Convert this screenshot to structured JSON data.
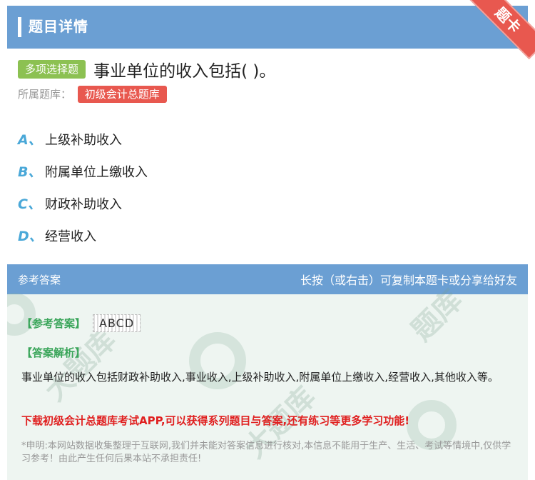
{
  "header": {
    "title": "题目详情",
    "ribbon": "题卡"
  },
  "question": {
    "type_label": "多项选择题",
    "text": "事业单位的收入包括( )。",
    "bank_label": "所属题库：",
    "bank_name": "初级会计总题库"
  },
  "options": [
    {
      "letter": "A、",
      "text": "上级补助收入"
    },
    {
      "letter": "B、",
      "text": "附属单位上缴收入"
    },
    {
      "letter": "C、",
      "text": "财政补助收入"
    },
    {
      "letter": "D、",
      "text": "经营收入"
    }
  ],
  "answer": {
    "header_left": "参考答案",
    "header_right": "长按（或右击）可复制本题卡或分享给好友",
    "ref_label": "【参考答案】",
    "ref_value": "ABCD",
    "analysis_label": "【答案解析】",
    "analysis_text": "事业单位的收入包括财政补助收入,事业收入,上级补助收入,附属单位上缴收入,经营收入,其他收入等。",
    "promo": "下载初级会计总题库考试APP,可以获得系列题目与答案,还有练习等更多学习功能!",
    "disclaimer": "*申明:本网站数据收集整理于互联网,我们并未能对答案信息进行核对,本信息不能用于生产、生活、考试等情境中,仅供学习参考！由此产生任何后果本站不承担责任!"
  },
  "colors": {
    "header_bg": "#6b9fd3",
    "ribbon": "#e8584f",
    "type_badge": "#8cc152",
    "option_letter": "#4aa8d8",
    "answer_bg": "#eef5f1",
    "promo": "#e02020",
    "green_label": "#3aa55a"
  }
}
